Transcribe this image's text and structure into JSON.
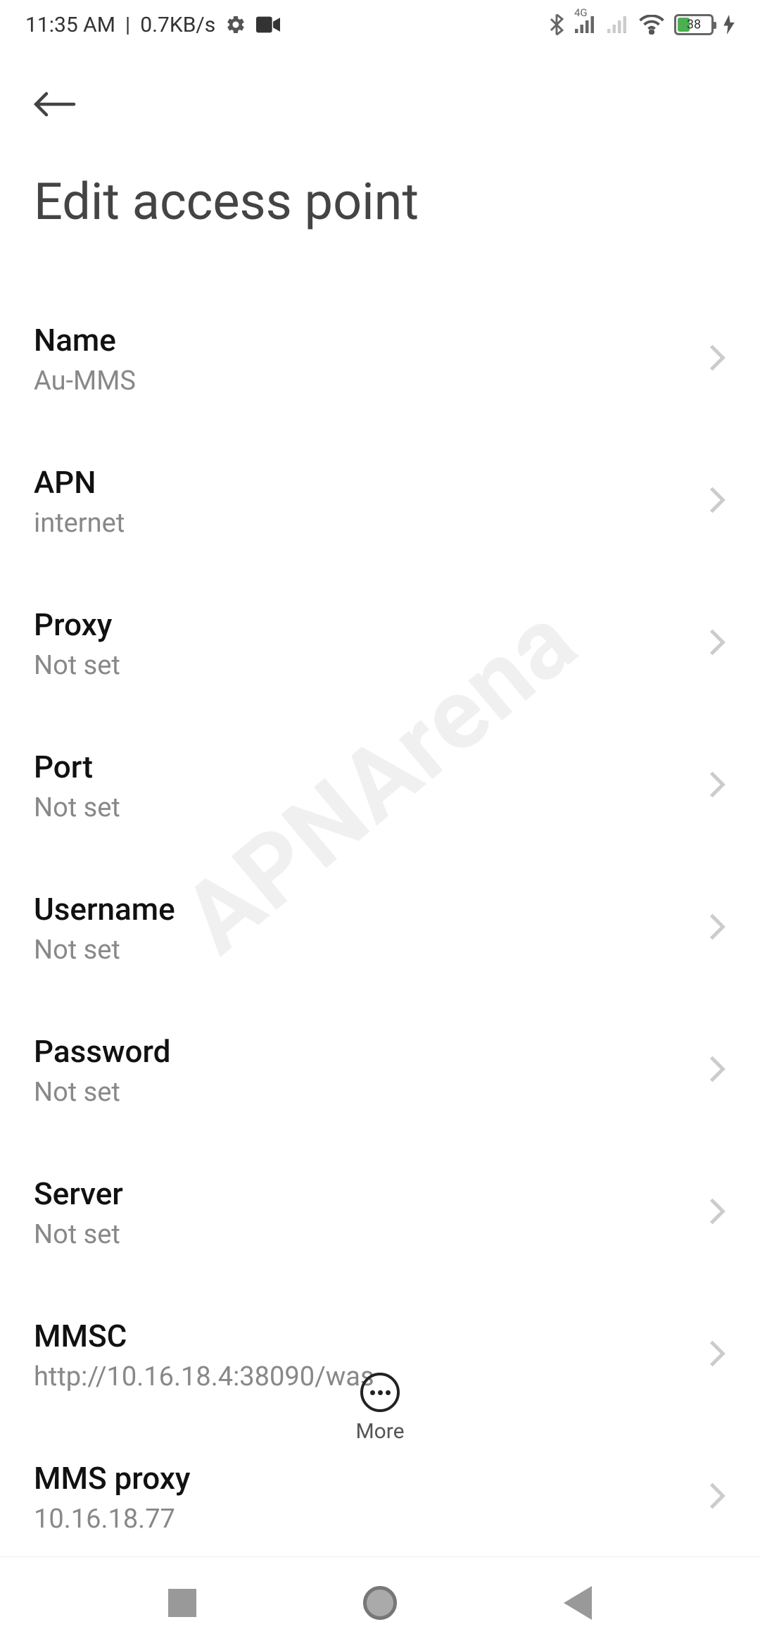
{
  "status_bar": {
    "time": "11:35 AM",
    "data_rate": "0.7KB/s",
    "battery_percent": "38",
    "network_label": "4G"
  },
  "header": {
    "title": "Edit access point"
  },
  "settings": [
    {
      "title": "Name",
      "value": "Au-MMS"
    },
    {
      "title": "APN",
      "value": "internet"
    },
    {
      "title": "Proxy",
      "value": "Not set"
    },
    {
      "title": "Port",
      "value": "Not set"
    },
    {
      "title": "Username",
      "value": "Not set"
    },
    {
      "title": "Password",
      "value": "Not set"
    },
    {
      "title": "Server",
      "value": "Not set"
    },
    {
      "title": "MMSC",
      "value": "http://10.16.18.4:38090/was"
    },
    {
      "title": "MMS proxy",
      "value": "10.16.18.77"
    }
  ],
  "bottom": {
    "more_label": "More"
  },
  "watermark": {
    "text": "APNArena"
  }
}
